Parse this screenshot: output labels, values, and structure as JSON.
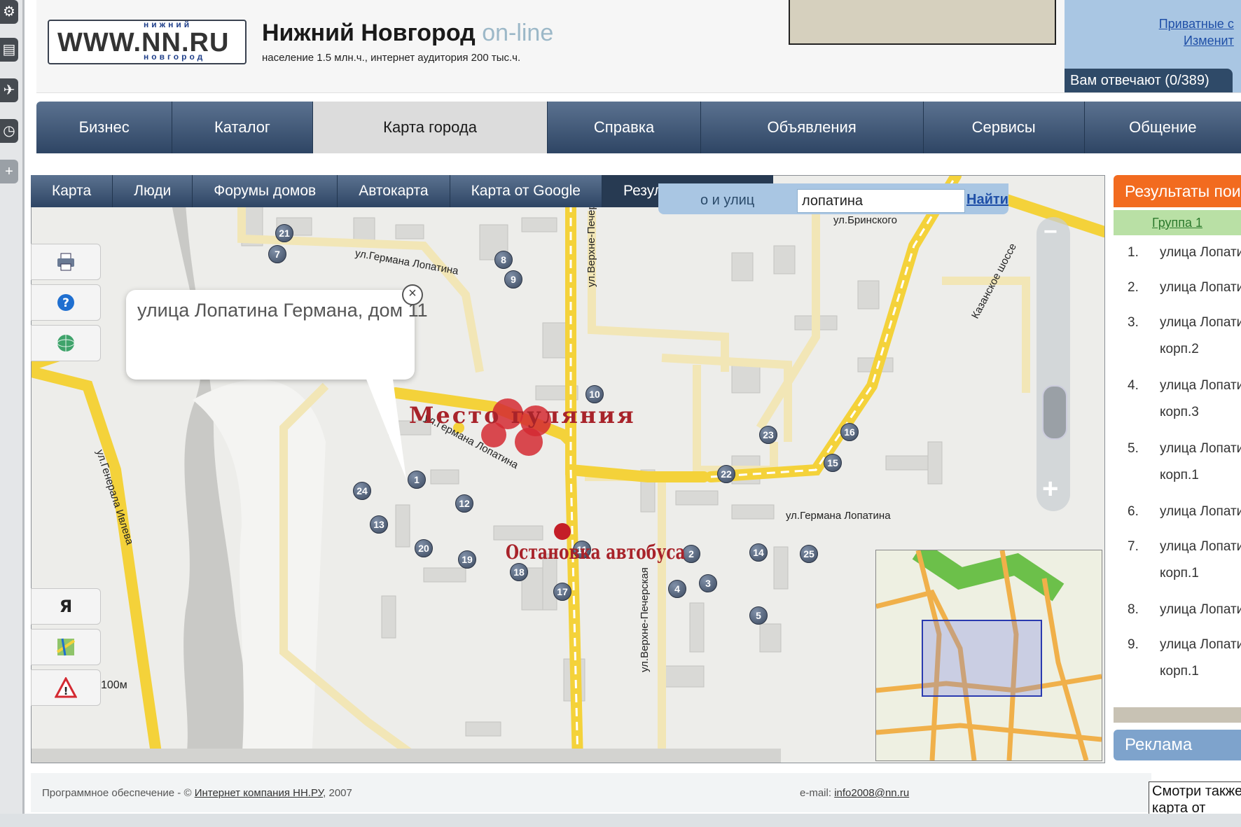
{
  "header": {
    "logo_top": "нижний",
    "logo_main": "WWW.NN.RU",
    "logo_bottom": "новгород",
    "title": "Нижний Новгород",
    "title_suffix": "on-line",
    "subtitle": "население 1.5 млн.ч., интернет аудитория 200 тыс.ч.",
    "right_links": [
      "Приватные с",
      "Изменит"
    ],
    "answering": "Вам отвечают (0/389)"
  },
  "main_nav": {
    "items": [
      {
        "label": "Бизнес"
      },
      {
        "label": "Каталог"
      },
      {
        "label": "Карта города"
      },
      {
        "label": "Справка"
      },
      {
        "label": "Объявления"
      },
      {
        "label": "Сервисы"
      },
      {
        "label": "Общение"
      }
    ],
    "active": "Карта города"
  },
  "map_nav": {
    "items": [
      {
        "label": "Карта"
      },
      {
        "label": "Люди"
      },
      {
        "label": "Форумы домов"
      },
      {
        "label": "Автокарта"
      },
      {
        "label": "Карта от Google"
      },
      {
        "label": "Результаты поиска"
      }
    ],
    "active": "Результаты поиска"
  },
  "search": {
    "label": "о и улиц",
    "value": "лопатина",
    "button": "Найти"
  },
  "map": {
    "popup_text": "улица Лопатина Германа, дом 11",
    "place_label": "Место гуляния",
    "stop_label": "Остановка автобуса",
    "scale": "100м",
    "streets": {
      "lopatina_1": "ул.Германа Лопатина",
      "lopatina_2": "ул.Германа Лопатина",
      "lopatina_3": "ул.Германа Лопатина",
      "verkhne_1": "ул.Верхне-Печерская",
      "verkhne_2": "ул.Верхне-Печерская",
      "kazanskoe": "Казанское шоссе",
      "ivaleva": "ул.Генерала Ивлева",
      "brinskogo": "ул.Бринского"
    },
    "markers": [
      "21",
      "7",
      "8",
      "9",
      "10",
      "1",
      "24",
      "12",
      "13",
      "20",
      "19",
      "18",
      "11",
      "17",
      "23",
      "16",
      "15",
      "22",
      "2",
      "14",
      "25",
      "4",
      "3",
      "5"
    ],
    "tools": [
      "print-icon",
      "help-icon",
      "globe-icon",
      "yandex-icon",
      "map-icon",
      "warning-icon"
    ],
    "yandex_label": "Я"
  },
  "results": {
    "title": "Результаты пои",
    "group": "Группа 1",
    "items": [
      {
        "num": "1.",
        "text": "улица Лопатин",
        "sub": ""
      },
      {
        "num": "2.",
        "text": "улица Лопатин",
        "sub": ""
      },
      {
        "num": "3.",
        "text": "улица Лопатин",
        "sub": "корп.2"
      },
      {
        "num": "4.",
        "text": "улица Лопатин",
        "sub": "корп.3"
      },
      {
        "num": "5.",
        "text": "улица Лопатин",
        "sub": "корп.1"
      },
      {
        "num": "6.",
        "text": "улица Лопатин",
        "sub": ""
      },
      {
        "num": "7.",
        "text": "улица Лопатин",
        "sub": "корп.1"
      },
      {
        "num": "8.",
        "text": "улица Лопатин",
        "sub": ""
      },
      {
        "num": "9.",
        "text": "улица Лопатин",
        "sub": "корп.1"
      }
    ],
    "ad": "Реклама"
  },
  "footer": {
    "left": "Программное обеспечение - ©",
    "company": "Интернет компания НН.РУ",
    "year": ", 2007",
    "email_label": "e-mail:",
    "email": "info2008@nn.ru",
    "see_also": "Смотри также:",
    "see_also_2": "карта от"
  },
  "colors": {
    "nav": "#3b5272",
    "road": "#f7d23c",
    "accent": "#f26b1f",
    "annotation": "#a8232a"
  }
}
